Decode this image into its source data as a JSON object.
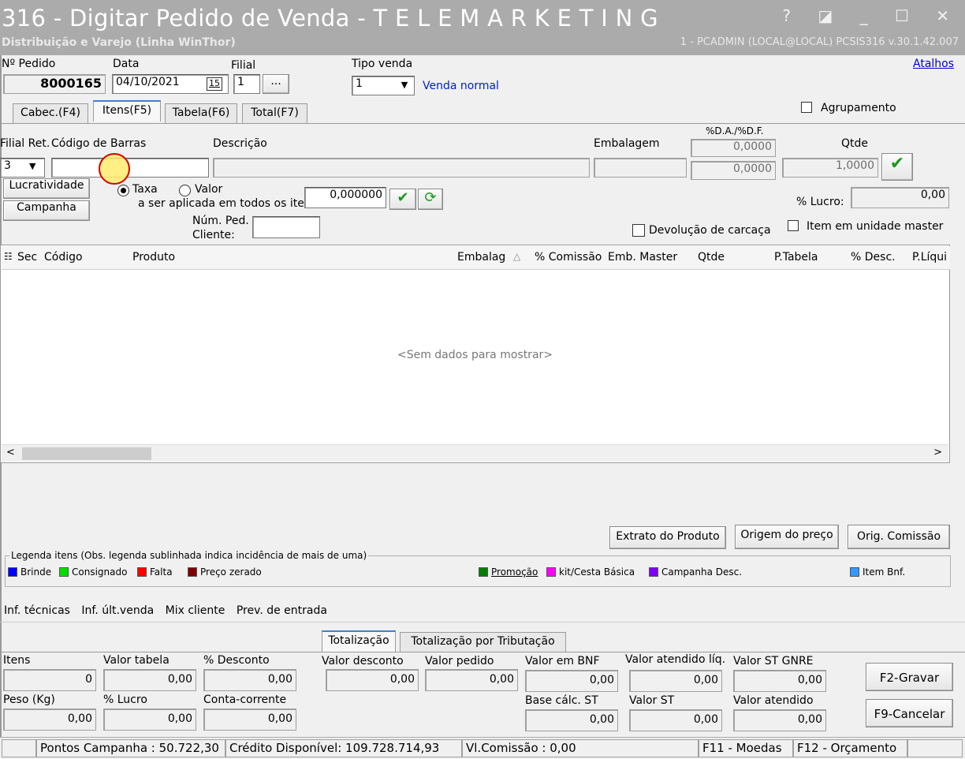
{
  "window": {
    "title": "316 - Digitar Pedido de Venda - T E L E M A R K E T I N G",
    "subtitle": "Distribuição e Varejo (Linha WinThor)",
    "session": "1 - PCADMIN (LOCAL@LOCAL)   PCSIS316  v.30.1.42.007",
    "controls": "? ◪ _ ☐ ✕"
  },
  "header": {
    "pedido_label": "Nº Pedido",
    "pedido_value": "8000165",
    "data_label": "Data",
    "data_value": "04/10/2021",
    "calendar_icon": "15",
    "filial_label": "Filial",
    "filial_value": "1",
    "filial_btn": "...",
    "tipo_venda_label": "Tipo venda",
    "tipo_venda_value": "1",
    "tipo_venda_desc": "Venda normal",
    "atalhos": "Atalhos"
  },
  "tabs": [
    "Cabec.(F4)",
    "Itens(F5)",
    "Tabela(F6)",
    "Total(F7)"
  ],
  "agrupamento": "Agrupamento",
  "item_entry": {
    "filial_ret_label": "Filial Ret.",
    "filial_ret_value": "3",
    "codigo_barras_label": "Código de Barras",
    "codigo_barras_value": "",
    "descricao_label": "Descrição",
    "embalagem_label": "Embalagem",
    "da_df_label": "%D.A./%D.F.",
    "da_value": "0,0000",
    "df_value": "0,0000",
    "qtde_label": "Qtde",
    "qtde_value": "1,0000",
    "lucratividade": "Lucratividade",
    "campanha": "Campanha",
    "taxa": "Taxa",
    "valor": "Valor",
    "aplicada_label": "a ser aplicada em todos os itens:",
    "aplicada_value": "0,000000",
    "lucro_label": "% Lucro:",
    "lucro_value": "0,00",
    "num_ped_label1": "Núm. Ped.",
    "num_ped_label2": "Cliente:",
    "devolucao": "Devolução de carcaça",
    "item_master": "Item em unidade master"
  },
  "grid": {
    "columns": [
      "Sec",
      "Código",
      "Produto",
      "Embalag",
      "% Comissão",
      "Emb. Master",
      "Qtde",
      "P.Tabela",
      "% Desc.",
      "P.Líqui"
    ],
    "empty_text": "<Sem dados para mostrar>"
  },
  "actions": {
    "extrato": "Extrato do Produto",
    "origem": "Origem do preço",
    "comissao": "Orig. Comissão"
  },
  "legend": {
    "title": "Legenda itens (Obs. legenda sublinhada indica incidência de mais de uma)",
    "items": [
      {
        "label": "Brinde",
        "color": "#0000ff"
      },
      {
        "label": "Consignado",
        "color": "#00e000"
      },
      {
        "label": "Falta",
        "color": "#ff0000"
      },
      {
        "label": "Preço zerado",
        "color": "#800000"
      },
      {
        "label": "Promoção",
        "color": "#008000"
      },
      {
        "label": "kit/Cesta Básica",
        "color": "#ff00ff"
      },
      {
        "label": "Campanha Desc.",
        "color": "#8000ff"
      },
      {
        "label": "Item Bnf.",
        "color": "#3399ff"
      }
    ]
  },
  "info_links": [
    "Inf. técnicas",
    "Inf. últ.venda",
    "Mix cliente",
    "Prev. de entrada"
  ],
  "totals_tabs": [
    "Totalização",
    "Totalização por Tributação"
  ],
  "totals": {
    "itens_label": "Itens",
    "itens": "0",
    "valor_tabela_label": "Valor tabela",
    "valor_tabela": "0,00",
    "desconto_pct_label": "% Desconto",
    "desconto_pct": "0,00",
    "valor_desconto_label": "Valor desconto",
    "valor_desconto": "0,00",
    "valor_pedido_label": "Valor pedido",
    "valor_pedido": "0,00",
    "valor_bnf_label": "Valor em BNF",
    "valor_bnf": "0,00",
    "valor_atendido_liq_label": "Valor atendido líq.",
    "valor_atendido_liq": "0,00",
    "valor_st_gnre_label": "Valor ST GNRE",
    "valor_st_gnre": "0,00",
    "peso_label": "Peso (Kg)",
    "peso": "0,00",
    "lucro_label": "% Lucro",
    "lucro": "0,00",
    "conta_corrente_label": "Conta-corrente",
    "conta_corrente": "0,00",
    "base_st_label": "Base cálc. ST",
    "base_st": "0,00",
    "valor_st_label": "Valor ST",
    "valor_st": "0,00",
    "valor_atendido_label": "Valor atendido",
    "valor_atendido": "0,00",
    "gravar": "F2-Gravar",
    "cancelar": "F9-Cancelar"
  },
  "status": {
    "pontos": "Pontos Campanha : 50.722,30",
    "credito": "Crédito Disponível: 109.728.714,93",
    "comissao": "Vl.Comissão : 0,00",
    "moedas": "F11 - Moedas",
    "orcamento": "F12 - Orçamento"
  }
}
